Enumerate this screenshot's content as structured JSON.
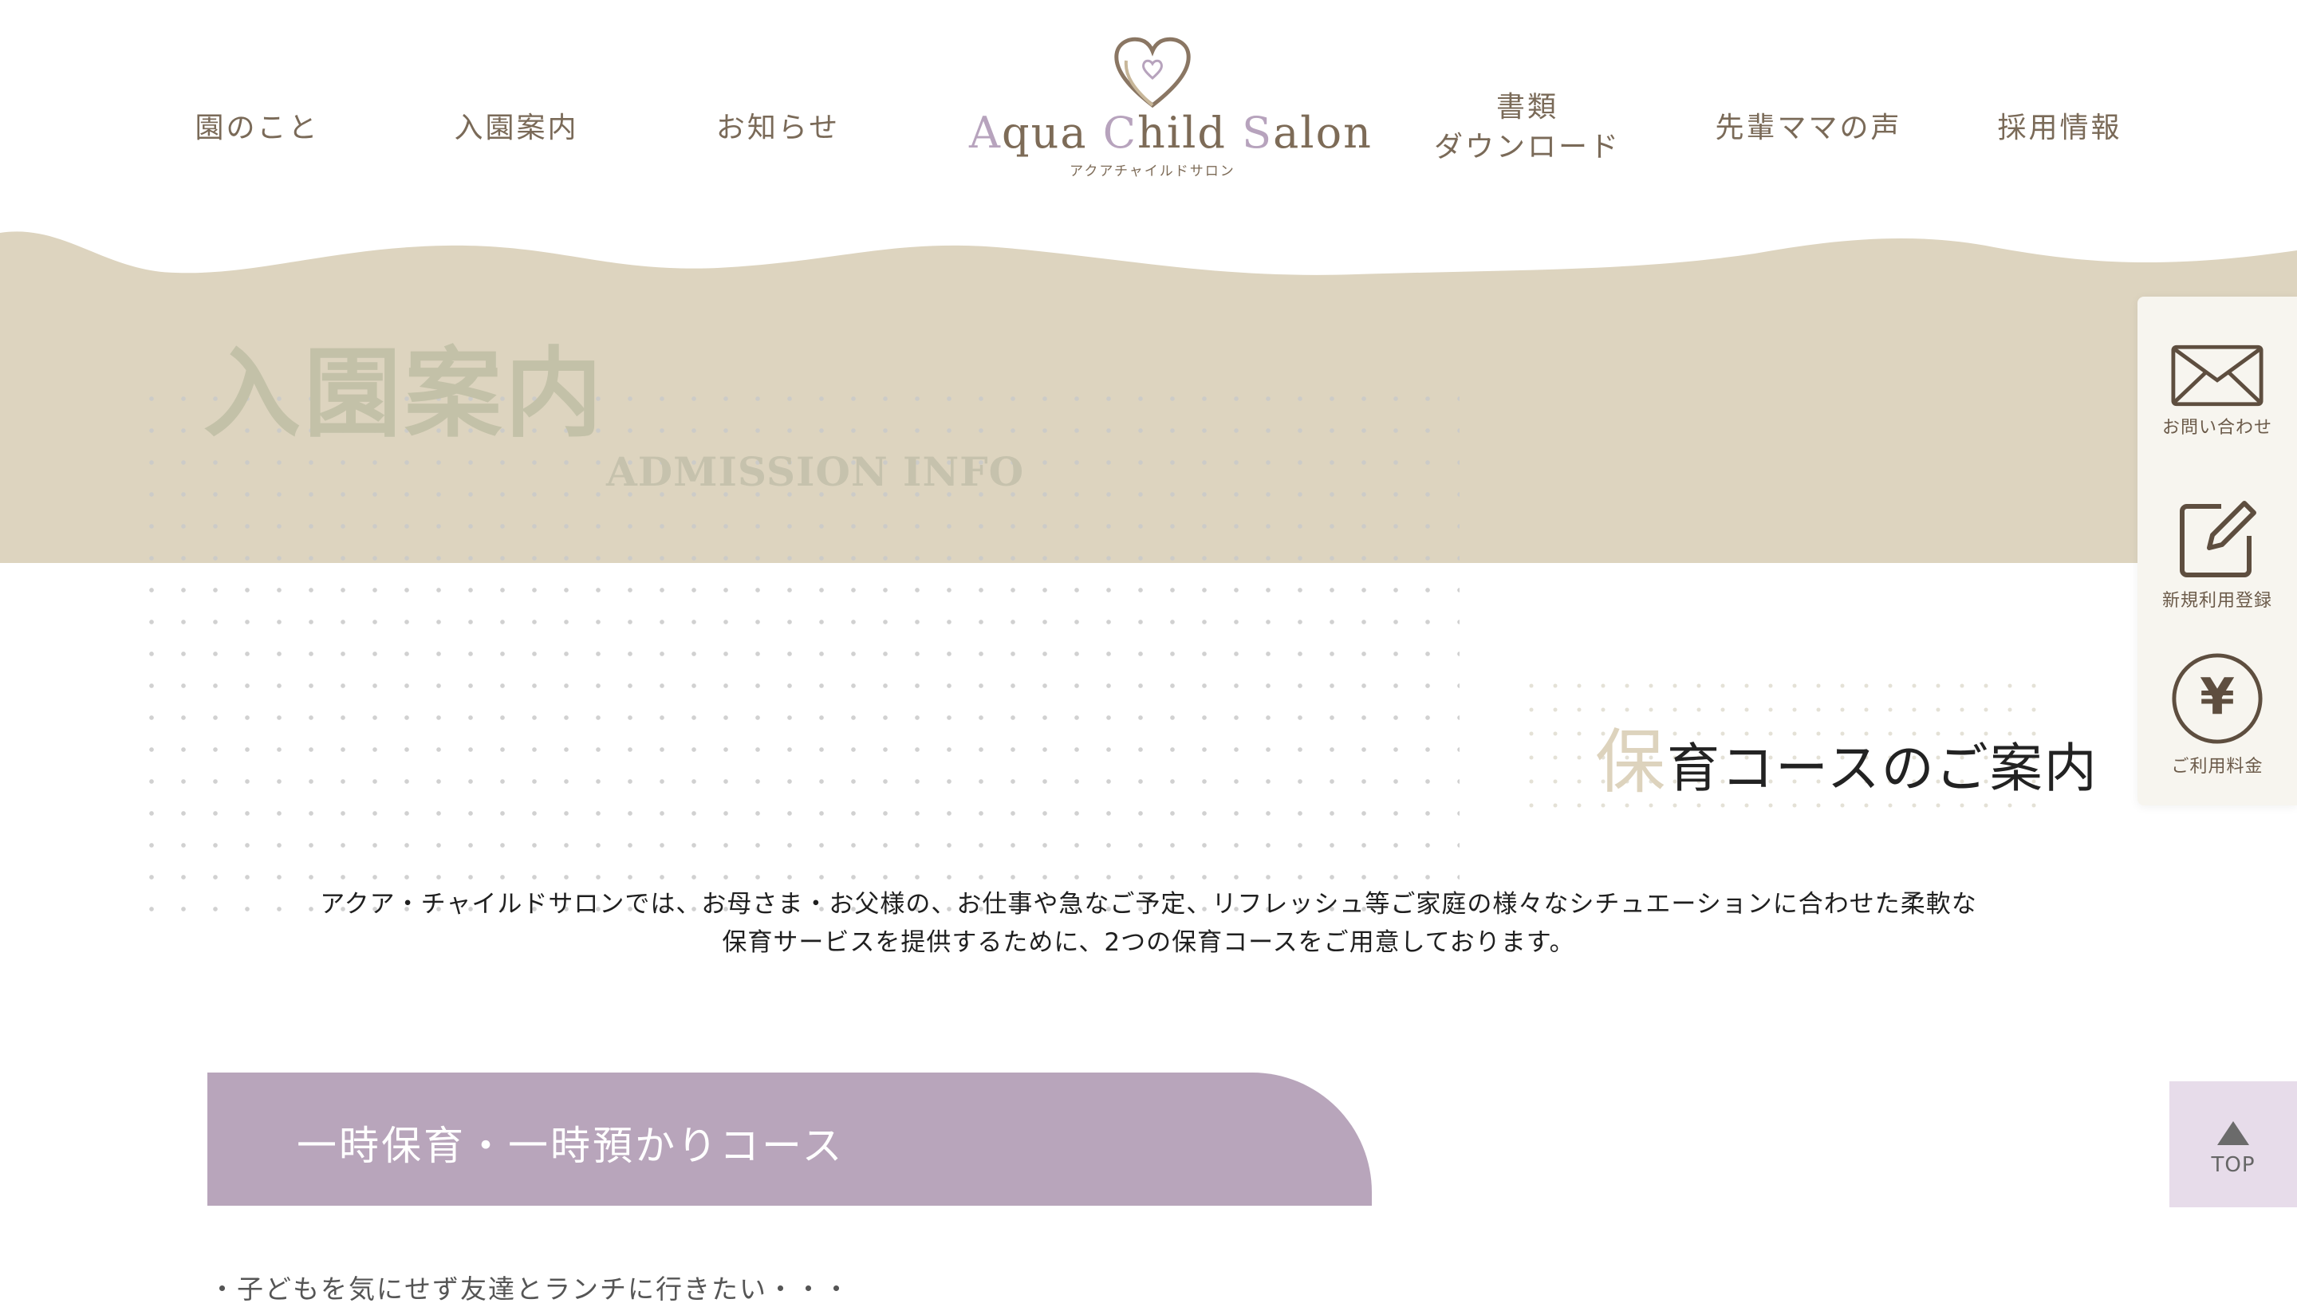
{
  "header": {
    "nav": [
      {
        "label": "園のこと"
      },
      {
        "label": "入園案内"
      },
      {
        "label": "お知らせ"
      },
      {
        "label": "書類\nダウンロード"
      },
      {
        "label": "先輩ママの声"
      },
      {
        "label": "採用情報"
      }
    ],
    "logo": {
      "name_parts": [
        "A",
        "qua ",
        "C",
        "hild ",
        "S",
        "alon"
      ],
      "kana": "アクアチャイルドサロン"
    }
  },
  "hero": {
    "title": "入園案内",
    "subtitle": "ADMISSION INFO"
  },
  "section": {
    "heading_first": "保",
    "heading_rest": "育コースのご案内",
    "intro": "アクア・チャイルドサロンでは、お母さま・お父様の、お仕事や急なご予定、リフレッシュ等ご家庭の様々なシチュエーションに合わせた柔軟な保育サービスを提供するために、2つの保育コースをご用意しております。"
  },
  "course": {
    "title": "一時保育・一時預かりコース",
    "bullet": "・子どもを気にせず友達とランチに行きたい・・・"
  },
  "side_panel": {
    "items": [
      {
        "label": "お問い合わせ",
        "icon": "mail-icon"
      },
      {
        "label": "新規利用登録",
        "icon": "edit-icon"
      },
      {
        "label": "ご利用料金",
        "icon": "yen-icon"
      }
    ],
    "yen_symbol": "¥"
  },
  "top_button": {
    "label": "TOP"
  },
  "colors": {
    "nav_text": "#7a6a58",
    "hero_band": "#ddd4bf",
    "course_bar": "#b8a5bb",
    "top_button": "#e7dcea"
  }
}
